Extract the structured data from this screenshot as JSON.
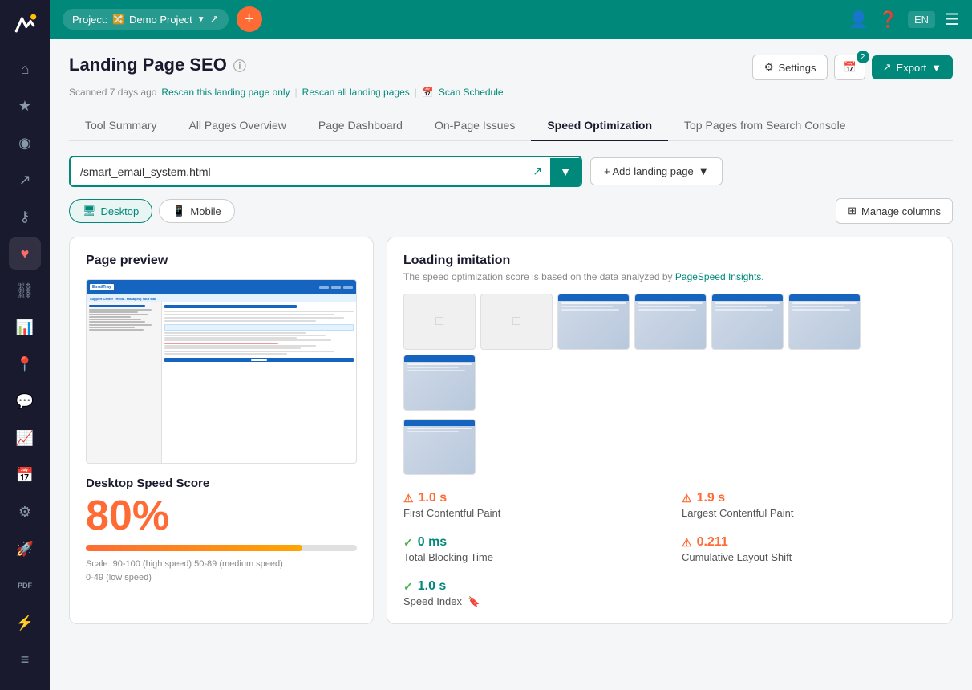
{
  "app": {
    "logo": "W",
    "topbar": {
      "project_label": "Project:",
      "project_name": "Demo Project",
      "add_btn": "+",
      "lang": "EN"
    }
  },
  "sidebar": {
    "icons": [
      {
        "name": "home-icon",
        "symbol": "⌂",
        "active": false
      },
      {
        "name": "star-icon",
        "symbol": "☆",
        "active": false
      },
      {
        "name": "globe-icon",
        "symbol": "◎",
        "active": false
      },
      {
        "name": "chart-icon",
        "symbol": "↗",
        "active": false
      },
      {
        "name": "key-icon",
        "symbol": "⚷",
        "active": false
      },
      {
        "name": "heart-icon",
        "symbol": "♥",
        "active": true
      },
      {
        "name": "link-icon",
        "symbol": "⛓",
        "active": false
      },
      {
        "name": "bar-chart-icon",
        "symbol": "▦",
        "active": false
      },
      {
        "name": "location-icon",
        "symbol": "◉",
        "active": false
      },
      {
        "name": "chat-icon",
        "symbol": "☐",
        "active": false
      },
      {
        "name": "analytics-icon",
        "symbol": "⬡",
        "active": false
      },
      {
        "name": "calendar2-icon",
        "symbol": "▦",
        "active": false
      },
      {
        "name": "settings-icon",
        "symbol": "⚙",
        "active": false
      },
      {
        "name": "rocket-icon",
        "symbol": "🚀",
        "active": false
      },
      {
        "name": "pdf-icon",
        "symbol": "PDF",
        "active": false
      },
      {
        "name": "bolt-icon",
        "symbol": "⚡",
        "active": false
      },
      {
        "name": "list-icon",
        "symbol": "≡",
        "active": false
      }
    ]
  },
  "page": {
    "title": "Landing Page SEO",
    "help_icon": "?",
    "scan_info": {
      "scanned_text": "Scanned 7 days ago",
      "rescan_page": "Rescan this landing page only",
      "divider1": "|",
      "rescan_all": "Rescan all landing pages",
      "divider2": "|",
      "scan_schedule": "Scan Schedule"
    },
    "header_buttons": {
      "settings": "Settings",
      "calendar_badge": "2",
      "export": "Export"
    }
  },
  "tabs": [
    {
      "label": "Tool Summary",
      "active": false
    },
    {
      "label": "All Pages Overview",
      "active": false
    },
    {
      "label": "Page Dashboard",
      "active": false
    },
    {
      "label": "On-Page Issues",
      "active": false
    },
    {
      "label": "Speed Optimization",
      "active": true
    },
    {
      "label": "Top Pages from Search Console",
      "active": false
    }
  ],
  "url_bar": {
    "url": "/smart_email_system.html",
    "placeholder": "/smart_email_system.html",
    "add_page_btn": "+ Add landing page"
  },
  "view_toggle": {
    "desktop_label": "Desktop",
    "mobile_label": "Mobile",
    "manage_cols_label": "Manage columns"
  },
  "left_panel": {
    "page_preview_title": "Page preview",
    "speed_score_title": "Desktop Speed Score",
    "speed_score_value": "80%",
    "speed_bar_pct": 80,
    "speed_scale": "Scale: 90-100 (high speed) 50-89 (medium speed)\n0-49 (low speed)"
  },
  "right_panel": {
    "loading_title": "Loading imitation",
    "loading_subtitle": "The speed optimization score is based on the data analyzed by",
    "pagespeed_link": "PageSpeed Insights.",
    "screenshots": [
      {
        "loaded": false,
        "label": ""
      },
      {
        "loaded": false,
        "label": ""
      },
      {
        "loaded": true,
        "label": ""
      },
      {
        "loaded": true,
        "label": ""
      },
      {
        "loaded": true,
        "label": ""
      },
      {
        "loaded": true,
        "label": ""
      },
      {
        "loaded": true,
        "label": ""
      }
    ],
    "screenshots_row2": [
      {
        "loaded": true,
        "label": ""
      }
    ],
    "metrics": [
      {
        "value": "1.0 s",
        "status": "orange",
        "label": "First Contentful Paint",
        "icon": "warn"
      },
      {
        "value": "1.9 s",
        "status": "orange",
        "label": "Largest Contentful Paint",
        "icon": "warn"
      },
      {
        "value": "0 ms",
        "status": "green",
        "label": "Total Blocking Time",
        "icon": "ok"
      },
      {
        "value": "0.211",
        "status": "orange",
        "label": "Cumulative Layout Shift",
        "icon": "warn"
      },
      {
        "value": "1.0 s",
        "status": "green",
        "label": "Speed Index",
        "icon": "ok",
        "has_bookmark": true
      }
    ]
  }
}
